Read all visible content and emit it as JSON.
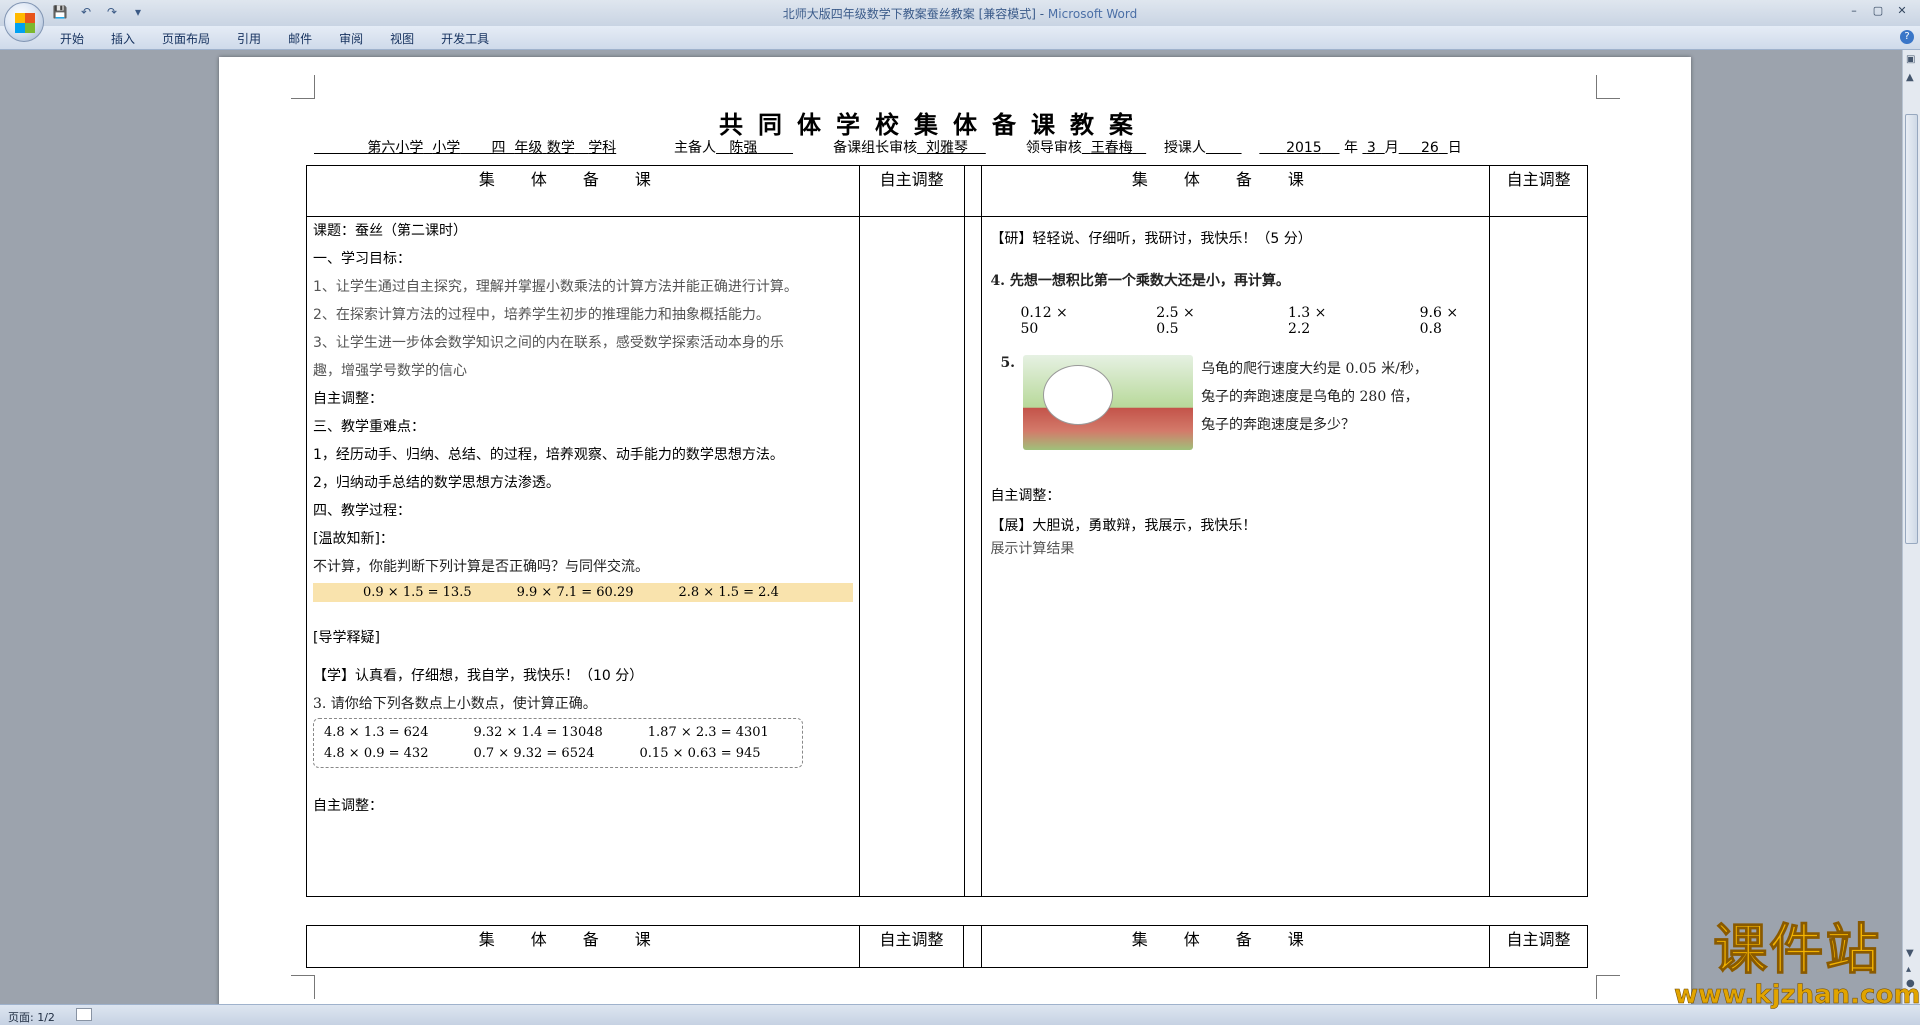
{
  "window": {
    "title": "北师大版四年级数学下教案蚕丝教案 [兼容模式] - ",
    "app_name": "Microsoft Word",
    "controls": [
      "–",
      "▢",
      "✕"
    ]
  },
  "qat": {
    "save": "💾",
    "undo": "↶",
    "redo": "↷",
    "more": "▾"
  },
  "ribbon": {
    "tabs": [
      "开始",
      "插入",
      "页面布局",
      "引用",
      "邮件",
      "审阅",
      "视图",
      "开发工具"
    ],
    "help": "?"
  },
  "doc": {
    "title": "共同体学校集体备课教案",
    "info": {
      "school": "第六小学",
      "school_suffix": "小学",
      "grade": "四",
      "grade_suffix": "年级",
      "subject": "数学",
      "subject_suffix": "学科",
      "planner_label": "主备人",
      "planner": "陈强",
      "group_label": "备课组长审核",
      "group_leader": "刘雅琴",
      "leader_label": "领导审核",
      "leader": "王春梅",
      "teacher_label": "授课人",
      "year": "2015",
      "year_label": "年",
      "month": "3",
      "month_label": "月",
      "day": "26",
      "day_label": "日"
    },
    "table_headers": {
      "main": "集体备课",
      "adjust": "自主调整"
    },
    "left_col": {
      "lesson": "课题：蚕丝（第二课时）",
      "goals_title": "一、学习目标：",
      "goal1": "1、让学生通过自主探究，理解并掌握小数乘法的计算方法并能正确进行计算。",
      "goal2": "2、在探索计算方法的过程中，培养学生初步的推理能力和抽象概括能力。",
      "goal3a": "3、让学生进一步体会数学知识之间的内在联系，感受数学探索活动本身的乐",
      "goal3b": "趣，增强学号数学的信心",
      "adjust1": "自主调整：",
      "key_title": "三、教学重难点：",
      "key1": "1，经历动手、归纳、总结、的过程，培养观察、动手能力的数学思想方法。",
      "key2": "2，归纳动手总结的数学思想方法渗透。",
      "process_title": "四、教学过程：",
      "review": "[温故知新]：",
      "review_q": "不计算，你能判断下列计算是否正确吗？与同伴交流。",
      "review_eqs": [
        "0.9 × 1.5 = 13.5",
        "9.9 × 7.1 = 60.29",
        "2.8 × 1.5 = 2.4"
      ],
      "guide": "[导学释疑]",
      "learn": "【学】认真看，仔细想，我自学，我快乐！（10 分）",
      "q3": "3. 请你给下列各数点上小数点，使计算正确。",
      "q3_row1": [
        "4.8 × 1.3 = 624",
        "9.32 × 1.4 = 13048",
        "1.87 × 2.3 = 4301"
      ],
      "q3_row2": [
        "4.8 × 0.9 = 432",
        "0.7 × 9.32 = 6524",
        "0.15 × 0.63 = 945"
      ],
      "adjust2": "自主调整："
    },
    "right_col": {
      "research": "【研】轻轻说、仔细听，我研讨，我快乐！（5 分）",
      "q4": "4. 先想一想积比第一个乘数大还是小，再计算。",
      "q4_items": [
        "0.12 × 50",
        "2.5 × 0.5",
        "1.3 × 2.2",
        "9.6 × 0.8"
      ],
      "q5_num": "5.",
      "q5_line1": "乌龟的爬行速度大约是 0.05 米/秒，",
      "q5_line2": "兔子的奔跑速度是乌龟的 280 倍，",
      "q5_line3": "兔子的奔跑速度是多少？",
      "adjust": "自主调整：",
      "show": "【展】大胆说，勇敢辩，我展示，我快乐！",
      "show_result": "展示计算结果"
    }
  },
  "status": {
    "page": "页面: 1/2"
  },
  "watermark": {
    "big": "课件站",
    "small": "www.kjzhan.com"
  }
}
